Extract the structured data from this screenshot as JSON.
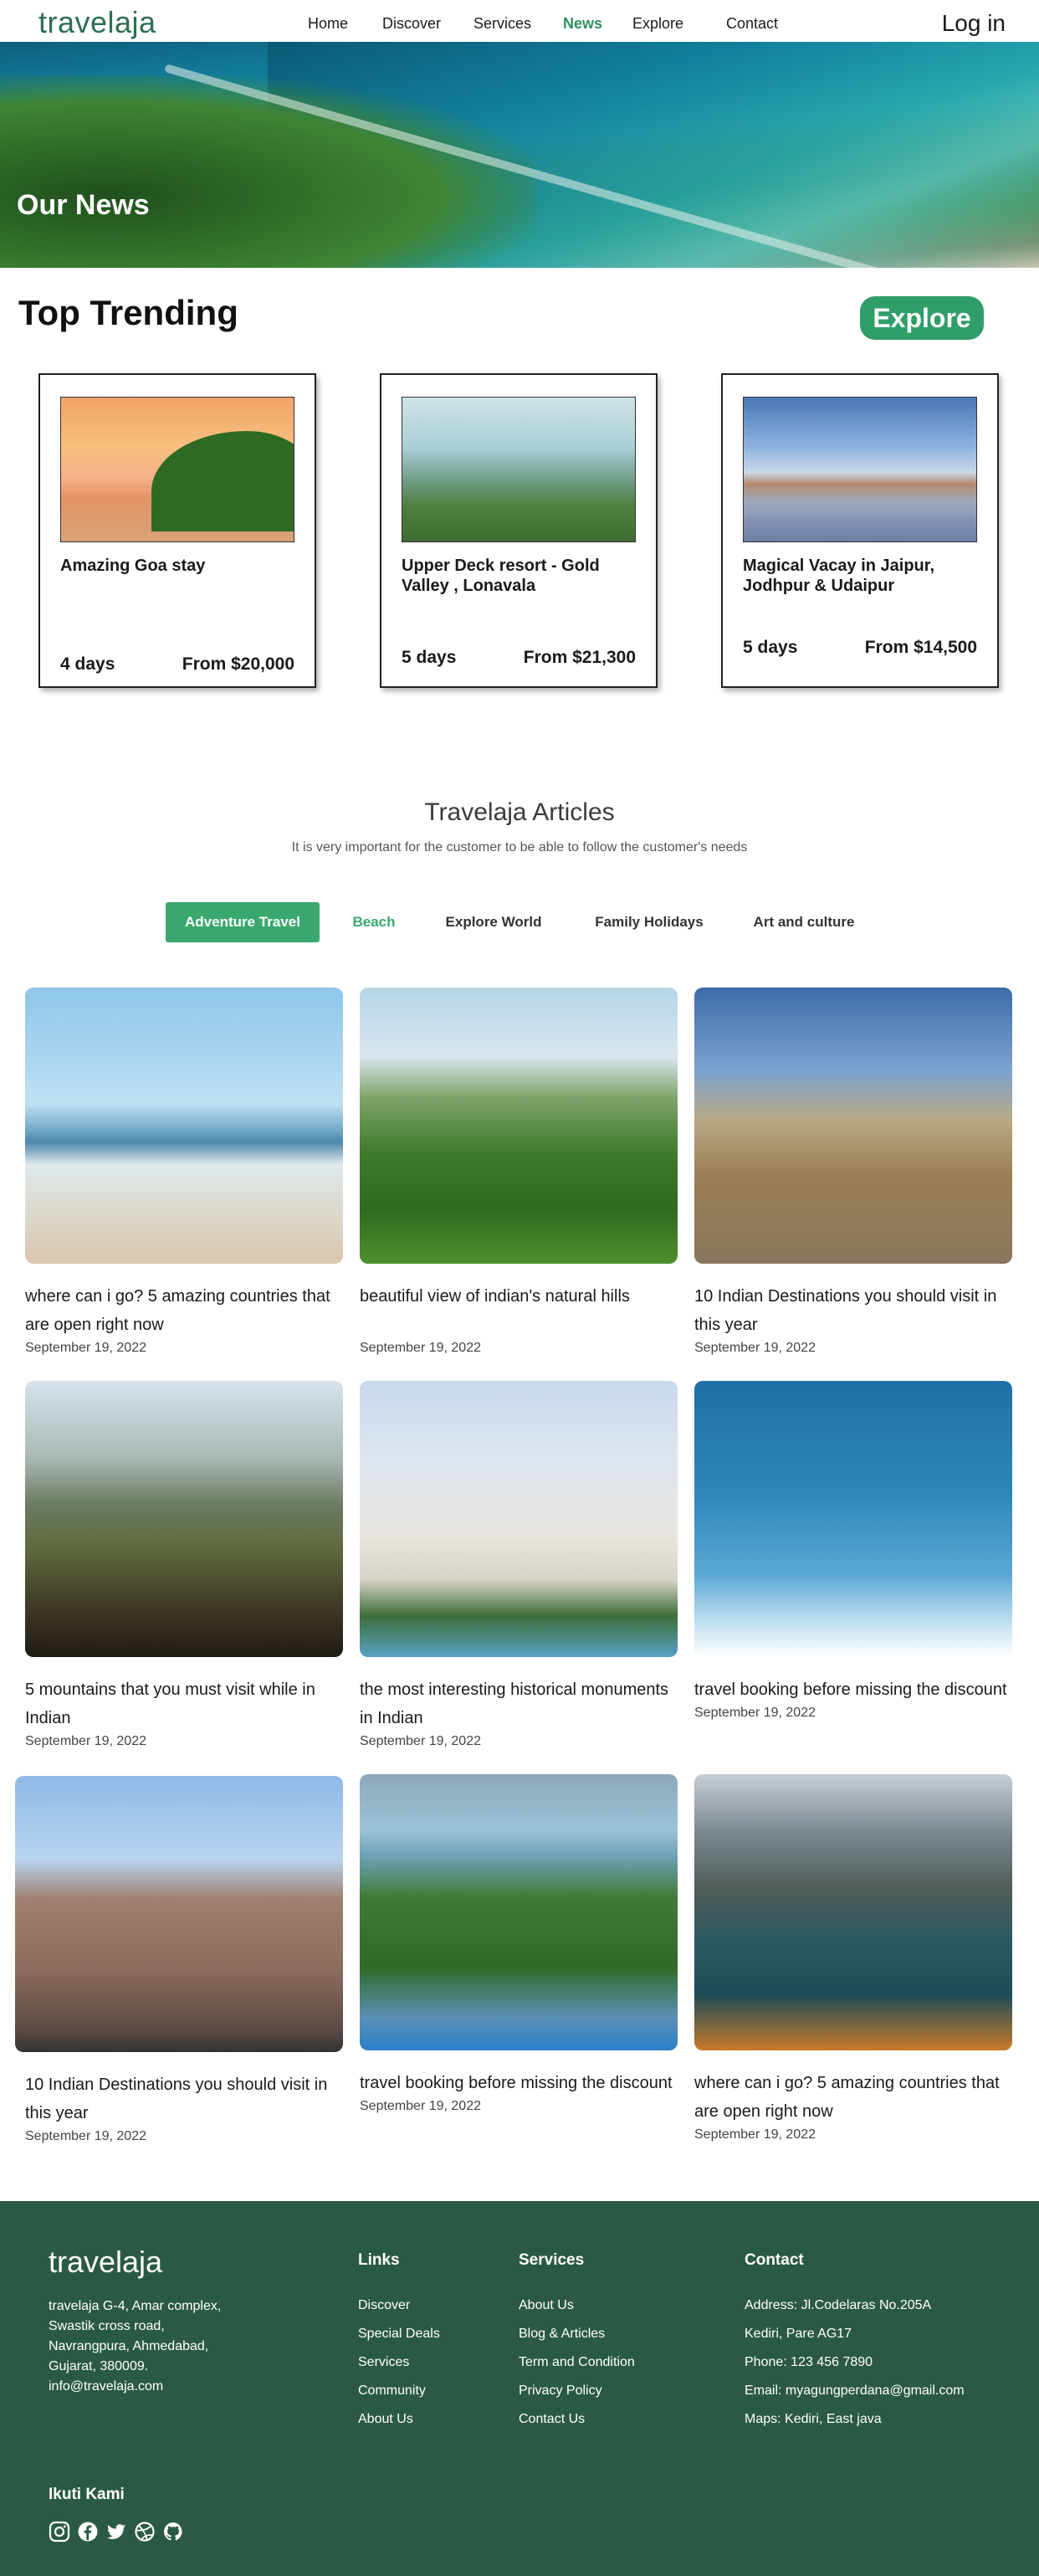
{
  "nav": {
    "logo": "travelaja",
    "links": [
      "Home",
      "Discover",
      "Services",
      "News",
      "Explore",
      "Contact"
    ],
    "active": "News",
    "login": "Log in"
  },
  "hero": {
    "title": "Our News"
  },
  "trending": {
    "title": "Top Trending",
    "explore_label": "Explore",
    "cards": [
      {
        "name": "Amazing Goa stay",
        "days": "4 days",
        "price": "From $20,000"
      },
      {
        "name": "Upper Deck resort - Gold Valley , Lonavala",
        "days": "5 days",
        "price": "From $21,300"
      },
      {
        "name": "Magical Vacay in Jaipur, Jodhpur & Udaipur",
        "days": "5 days",
        "price": "From $14,500"
      }
    ]
  },
  "articles": {
    "title": "Travelaja Articles",
    "subtitle": "It is very important for the customer to be able to follow the customer's needs",
    "tabs": [
      "Adventure Travel",
      "Beach",
      "Explore World",
      "Family Holidays",
      "Art and culture"
    ],
    "active_tab": "Adventure Travel",
    "items": [
      {
        "title": "where can i go? 5 amazing countries that are open right now",
        "date": "September 19, 2022"
      },
      {
        "title": "beautiful view of indian's natural hills",
        "date": "September 19, 2022"
      },
      {
        "title": "10 Indian Destinations you should visit in this year",
        "date": "September 19, 2022"
      },
      {
        "title": "5 mountains that you must visit while in Indian",
        "date": "September 19, 2022"
      },
      {
        "title": "the most interesting historical monuments in Indian",
        "date": "September 19, 2022"
      },
      {
        "title": "travel booking before missing the discount",
        "date": "September 19, 2022"
      },
      {
        "title": "10 Indian Destinations you should visit in this year",
        "date": "September 19, 2022"
      },
      {
        "title": "travel booking before missing the discount",
        "date": "September 19, 2022"
      },
      {
        "title": "where can i go? 5 amazing countries that are open right now",
        "date": "September 19, 2022"
      }
    ]
  },
  "footer": {
    "logo": "travelaja",
    "address": "travelaja G-4, Amar complex, Swastik cross road, Navrangpura, Ahmedabad, Gujarat, 380009. info@travelaja.com",
    "links": {
      "title": "Links",
      "items": [
        "Discover",
        "Special Deals",
        "Services",
        "Community",
        "About Us"
      ]
    },
    "services": {
      "title": "Services",
      "items": [
        "About Us",
        "Blog & Articles",
        "Term and Condition",
        "Privacy Policy",
        "Contact Us"
      ]
    },
    "contact": {
      "title": "Contact",
      "items": [
        "Address: Jl.Codelaras No.205A",
        "Kediri, Pare AG17",
        "Phone: 123 456 7890",
        "Email: myagungperdana@gmail.com",
        "Maps: Kediri, East java"
      ]
    },
    "follow_title": "Ikuti Kami",
    "social_icons": [
      "instagram-icon",
      "facebook-icon",
      "twitter-icon",
      "dribbble-icon",
      "github-icon"
    ]
  },
  "colors": {
    "brand": "#2e6e52",
    "accent": "#3aa86e",
    "footer_bg": "#2b5a44"
  }
}
